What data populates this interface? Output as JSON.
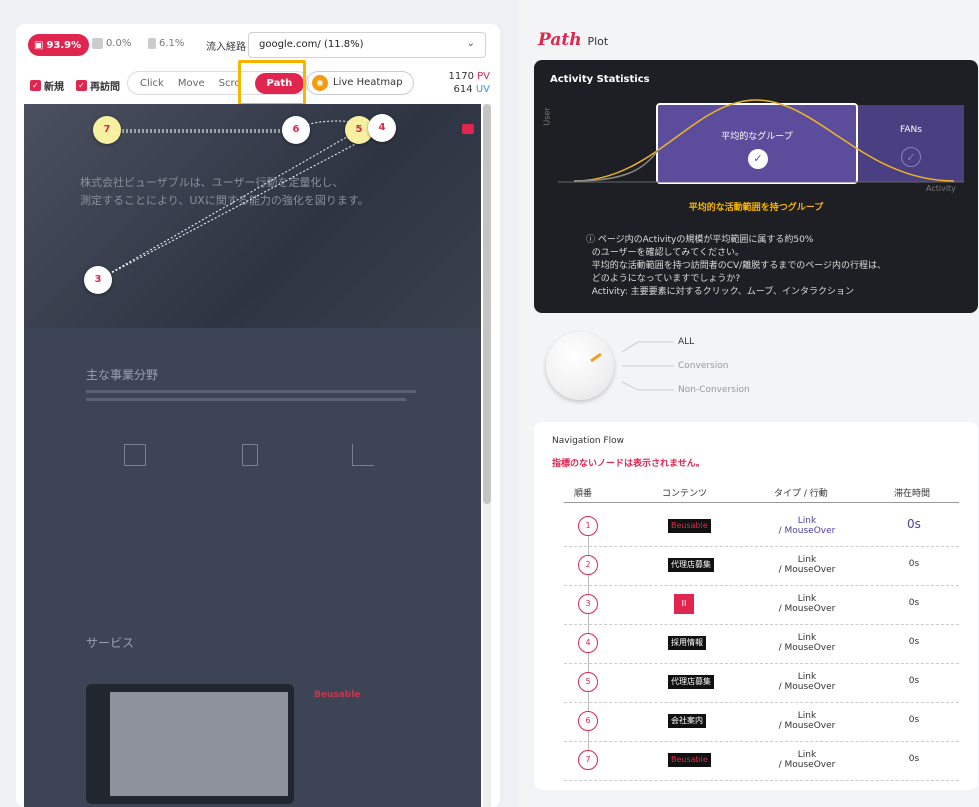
{
  "toolbar": {
    "device_desktop": "93.9%",
    "device_tablet": "0.0%",
    "device_mobile": "6.1%",
    "referrer_label": "流入経路",
    "referrer_value": "google.com/ (11.8%)",
    "new_label": "新規",
    "returning_label": "再訪問",
    "tabs": [
      "Click",
      "Move",
      "Scro",
      "Path"
    ],
    "live_heatmap": "Live Heatmap",
    "pv": "1170",
    "pv_unit": "PV",
    "uv": "614",
    "uv_unit": "UV"
  },
  "screenshot": {
    "hero_line1": "株式会社ビューザブルは、ユーザー行動を定量化し、",
    "hero_line2": "測定することにより、UXに関する能力の強化を図ります。",
    "section1": "主な事業分野",
    "section2": "サービス",
    "path_points": [
      "7",
      "6",
      "5",
      "4",
      "3"
    ],
    "brand": "Beusable"
  },
  "plot": {
    "logo": "Path",
    "logo_sub": "Plot",
    "stats_title": "Activity Statistics",
    "y_axis": "User",
    "x_axis": "Activity",
    "group_label": "平均的なグループ",
    "fans_label": "FANs",
    "group_caption": "平均的な活動範囲を持つグループ",
    "note": "ⓘ ページ内のActivityの規模が平均範囲に属する約50%\n  のユーザーを確認してみてください。\n  平均的な活動範囲を持つ訪問者のCV/離脱するまでのページ内の行程は、\n  どのようになっていますでしょうか?\n  Activity: 主要要素に対するクリック、ムーブ、インタラクション",
    "knob_options": [
      "ALL",
      "Conversion",
      "Non-Conversion"
    ],
    "accent": "#e0264f",
    "purple": "#5b4d9c"
  },
  "flow": {
    "title": "Navigation Flow",
    "warning": "指標のないノードは表示されません。",
    "headers": [
      "順番",
      "コンテンツ",
      "タイプ / 行動",
      "滞在時間"
    ],
    "rows": [
      {
        "n": "1",
        "content": "Beusable",
        "type": "Link",
        "action": "/ MouseOver",
        "time": "0s"
      },
      {
        "n": "2",
        "content": "代理店募集",
        "type": "Link",
        "action": "/ MouseOver",
        "time": "0s"
      },
      {
        "n": "3",
        "content": "II",
        "type": "Link",
        "action": "/ MouseOver",
        "time": "0s"
      },
      {
        "n": "4",
        "content": "採用情報",
        "type": "Link",
        "action": "/ MouseOver",
        "time": "0s"
      },
      {
        "n": "5",
        "content": "代理店募集",
        "type": "Link",
        "action": "/ MouseOver",
        "time": "0s"
      },
      {
        "n": "6",
        "content": "会社案内",
        "type": "Link",
        "action": "/ MouseOver",
        "time": "0s"
      },
      {
        "n": "7",
        "content": "Beusable",
        "type": "Link",
        "action": "/ MouseOver",
        "time": "0s"
      }
    ]
  }
}
